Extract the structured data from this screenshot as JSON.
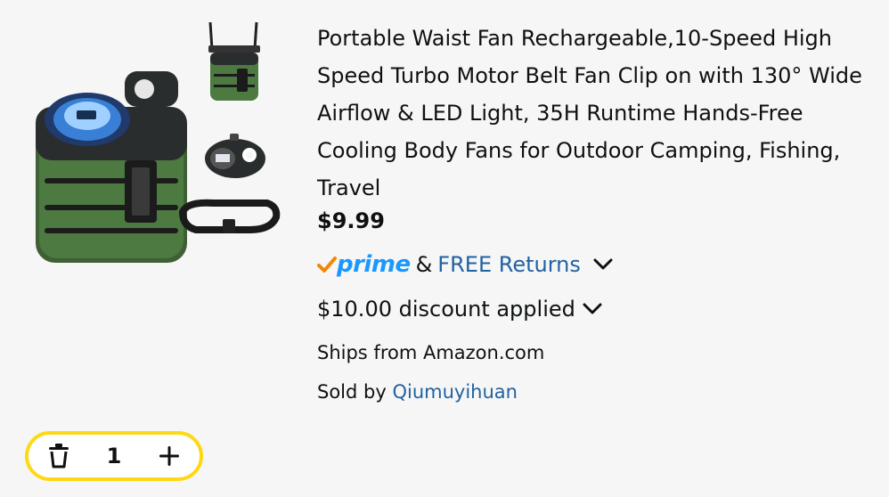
{
  "product": {
    "title": "Portable Waist Fan Rechargeable,10-Speed High Speed Turbo Motor Belt Fan Clip on with 130° Wide Airflow & LED Light, 35H Runtime Hands-Free Cooling Body Fans for Outdoor Camping, Fishing, Travel",
    "price": "$9.99",
    "prime_label": "prime",
    "ampersand": "&",
    "free_returns": "FREE Returns",
    "discount": "$10.00 discount applied",
    "ships_from": "Ships from Amazon.com",
    "sold_by_label": "Sold by",
    "seller": "Qiumuyihuan"
  },
  "quantity": {
    "value": "1"
  },
  "colors": {
    "prime_blue": "#1a98ff",
    "prime_check": "#f08804",
    "link_blue": "#2162a1",
    "stepper_border": "#ffd814",
    "product_green": "#4a6b3a"
  },
  "icons": {
    "delete": "trash-icon",
    "increment": "plus-icon",
    "expand": "chevron-down-icon",
    "prime_check": "check-icon"
  }
}
